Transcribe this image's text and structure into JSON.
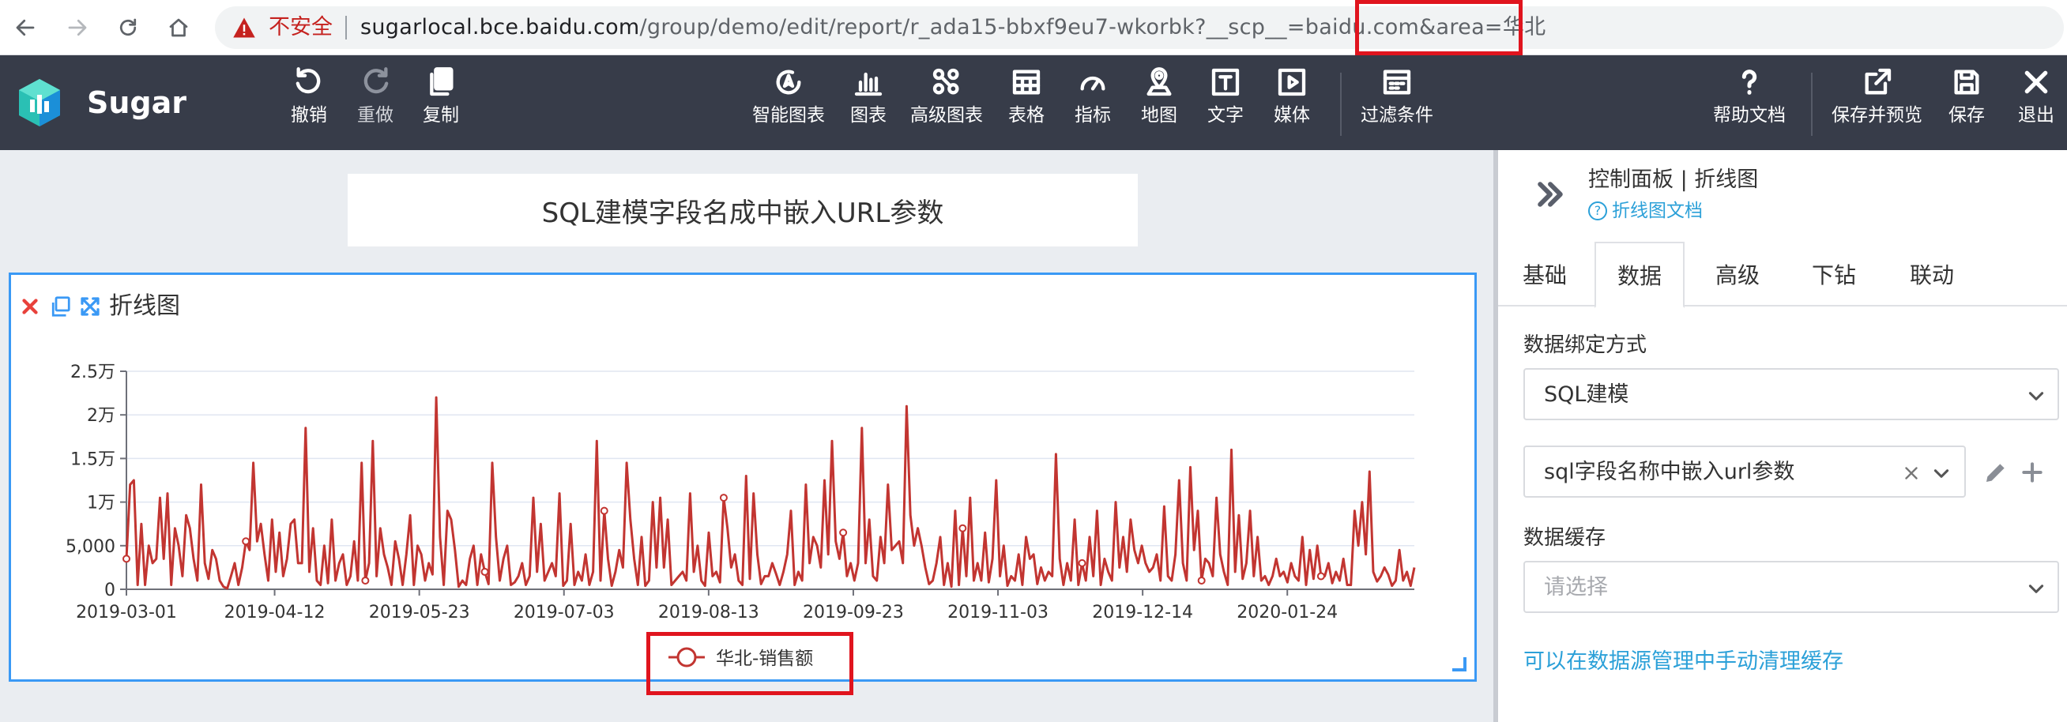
{
  "browser": {
    "insecure_label": "不安全",
    "url_host": "sugarlocal.bce.baidu.com",
    "url_path": "/group/demo/edit/report/r_ada15-bbxf9eu7-wkorbk?__scp__=baidu.com&area=华北"
  },
  "toolbar": {
    "brand": "Sugar",
    "undo": "撤销",
    "redo": "重做",
    "copy": "复制",
    "smart_chart": "智能图表",
    "chart": "图表",
    "advanced_chart": "高级图表",
    "table": "表格",
    "indicator": "指标",
    "map": "地图",
    "text": "文字",
    "media": "媒体",
    "filter": "过滤条件",
    "help": "帮助文档",
    "save_preview": "保存并预览",
    "save": "保存",
    "exit": "退出"
  },
  "report": {
    "title": "SQL建模字段名成中嵌入URL参数",
    "chart_title": "折线图"
  },
  "panel": {
    "title": "控制面板 | 折线图",
    "doc_link": "折线图文档",
    "tabs": [
      "基础",
      "数据",
      "高级",
      "下钻",
      "联动"
    ],
    "active_tab": "数据",
    "binding_label": "数据绑定方式",
    "binding_value": "SQL建模",
    "model_value": "sql字段名称中嵌入url参数",
    "cache_label": "数据缓存",
    "cache_placeholder": "请选择",
    "cache_link": "可以在数据源管理中手动清理缓存"
  },
  "colors": {
    "toolbar_bg": "#373c49",
    "accent_blue": "#3a99f5",
    "link": "#2ba0d8",
    "series": "#c23531",
    "highlight": "#e0141e"
  },
  "chart_data": {
    "type": "line",
    "x_ticks": [
      "2019-03-01",
      "2019-04-12",
      "2019-05-23",
      "2019-07-03",
      "2019-08-13",
      "2019-09-23",
      "2019-11-03",
      "2019-12-14",
      "2020-01-24"
    ],
    "y_ticks": [
      "0",
      "5,000",
      "1万",
      "1.5万",
      "2万",
      "2.5万"
    ],
    "ylim": [
      0,
      25000
    ],
    "x_start": "2019-03-01",
    "x_end": "2020-02-29",
    "grid": "horizontal",
    "legend_position": "bottom-center",
    "series": [
      {
        "name": "华北-销售额",
        "values": [
          3500,
          12000,
          12500,
          500,
          7500,
          500,
          5000,
          3000,
          3500,
          10500,
          3500,
          11000,
          500,
          7000,
          5000,
          1500,
          8500,
          7000,
          3500,
          1000,
          12000,
          3000,
          1200,
          4500,
          3500,
          1000,
          300,
          100,
          1500,
          3000,
          500,
          2500,
          5500,
          4500,
          14500,
          5500,
          7500,
          4000,
          1000,
          8000,
          2000,
          6500,
          1500,
          3500,
          7500,
          8000,
          3000,
          3000,
          18500,
          2000,
          7000,
          1000,
          500,
          5000,
          700,
          8000,
          1000,
          3000,
          4000,
          500,
          1500,
          5500,
          1000,
          14500,
          1000,
          3000,
          17000,
          1500,
          7000,
          4000,
          2500,
          500,
          5500,
          3500,
          500,
          4000,
          8500,
          500,
          5000,
          4000,
          1000,
          3000,
          1700,
          22000,
          6000,
          500,
          9000,
          8000,
          4500,
          300,
          1000,
          500,
          3500,
          5000,
          500,
          4000,
          2000,
          600,
          14500,
          6000,
          1000,
          3500,
          5000,
          500,
          800,
          1500,
          3000,
          500,
          1500,
          10500,
          2000,
          7500,
          1000,
          2000,
          3000,
          1500,
          11000,
          400,
          1000,
          7500,
          500,
          2000,
          1000,
          4000,
          500,
          2000,
          17000,
          1000,
          9000,
          3500,
          400,
          2000,
          4500,
          2500,
          14500,
          8000,
          3500,
          500,
          6000,
          400,
          1000,
          10000,
          2500,
          10500,
          2500,
          8000,
          500,
          1000,
          1500,
          2000,
          1000,
          11000,
          2000,
          5000,
          1000,
          400,
          6500,
          1500,
          2000,
          800,
          10500,
          7000,
          2500,
          4000,
          1000,
          500,
          13000,
          1200,
          11000,
          4000,
          600,
          1500,
          1500,
          3000,
          1800,
          500,
          2000,
          4000,
          9000,
          500,
          2000,
          1000,
          12000,
          3000,
          6000,
          5000,
          2500,
          12500,
          4000,
          17000,
          5500,
          3500,
          6500,
          1500,
          3000,
          1000,
          3000,
          18500,
          3000,
          8000,
          1500,
          1000,
          6000,
          3000,
          12000,
          4500,
          5000,
          5500,
          3000,
          21000,
          8500,
          5000,
          7000,
          5000,
          2500,
          600,
          1000,
          3000,
          6000,
          500,
          3000,
          300,
          9000,
          500,
          7000,
          1500,
          10500,
          1000,
          3000,
          1000,
          6500,
          800,
          3500,
          12500,
          1500,
          5000,
          400,
          1500,
          1000,
          4000,
          500,
          6000,
          3500,
          4000,
          600,
          2500,
          1000,
          2000,
          1500,
          15500,
          3500,
          500,
          3000,
          1000,
          8000,
          500,
          3000,
          1000,
          6000,
          1500,
          9000,
          500,
          3500,
          2000,
          1000,
          10000,
          2500,
          6000,
          2000,
          8000,
          4500,
          3000,
          5000,
          3000,
          2000,
          2500,
          4000,
          1000,
          9500,
          1500,
          1000,
          4000,
          12500,
          3000,
          1000,
          14000,
          4500,
          9000,
          1000,
          3500,
          3000,
          1500,
          10500,
          4000,
          2000,
          500,
          16000,
          2000,
          8500,
          1200,
          3000,
          9000,
          1500,
          6000,
          1000,
          1500,
          500,
          1500,
          3500,
          1500,
          2000,
          800,
          3000,
          1500,
          1000,
          6000,
          500,
          4500,
          1200,
          5000,
          1500,
          1500,
          3000,
          700,
          2000,
          1000,
          3500,
          500,
          500,
          9000,
          5000,
          10000,
          4000,
          13500,
          2000,
          900,
          1500,
          2500,
          1700,
          400,
          1000,
          4500,
          1000,
          2000,
          400,
          2500
        ]
      }
    ]
  }
}
